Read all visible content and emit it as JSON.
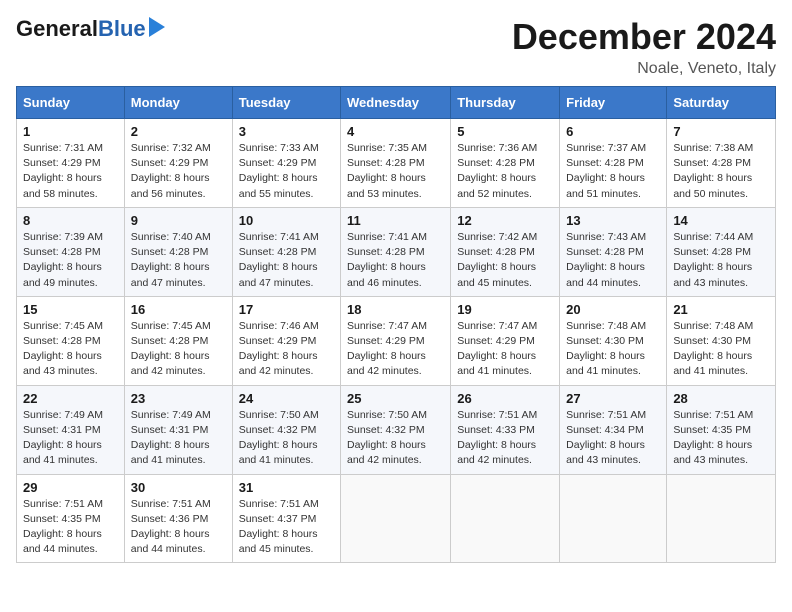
{
  "logo": {
    "general": "General",
    "blue": "Blue"
  },
  "title": "December 2024",
  "location": "Noale, Veneto, Italy",
  "days_of_week": [
    "Sunday",
    "Monday",
    "Tuesday",
    "Wednesday",
    "Thursday",
    "Friday",
    "Saturday"
  ],
  "weeks": [
    [
      {
        "day": 1,
        "sunrise": "7:31 AM",
        "sunset": "4:29 PM",
        "daylight": "8 hours and 58 minutes."
      },
      {
        "day": 2,
        "sunrise": "7:32 AM",
        "sunset": "4:29 PM",
        "daylight": "8 hours and 56 minutes."
      },
      {
        "day": 3,
        "sunrise": "7:33 AM",
        "sunset": "4:29 PM",
        "daylight": "8 hours and 55 minutes."
      },
      {
        "day": 4,
        "sunrise": "7:35 AM",
        "sunset": "4:28 PM",
        "daylight": "8 hours and 53 minutes."
      },
      {
        "day": 5,
        "sunrise": "7:36 AM",
        "sunset": "4:28 PM",
        "daylight": "8 hours and 52 minutes."
      },
      {
        "day": 6,
        "sunrise": "7:37 AM",
        "sunset": "4:28 PM",
        "daylight": "8 hours and 51 minutes."
      },
      {
        "day": 7,
        "sunrise": "7:38 AM",
        "sunset": "4:28 PM",
        "daylight": "8 hours and 50 minutes."
      }
    ],
    [
      {
        "day": 8,
        "sunrise": "7:39 AM",
        "sunset": "4:28 PM",
        "daylight": "8 hours and 49 minutes."
      },
      {
        "day": 9,
        "sunrise": "7:40 AM",
        "sunset": "4:28 PM",
        "daylight": "8 hours and 47 minutes."
      },
      {
        "day": 10,
        "sunrise": "7:41 AM",
        "sunset": "4:28 PM",
        "daylight": "8 hours and 47 minutes."
      },
      {
        "day": 11,
        "sunrise": "7:41 AM",
        "sunset": "4:28 PM",
        "daylight": "8 hours and 46 minutes."
      },
      {
        "day": 12,
        "sunrise": "7:42 AM",
        "sunset": "4:28 PM",
        "daylight": "8 hours and 45 minutes."
      },
      {
        "day": 13,
        "sunrise": "7:43 AM",
        "sunset": "4:28 PM",
        "daylight": "8 hours and 44 minutes."
      },
      {
        "day": 14,
        "sunrise": "7:44 AM",
        "sunset": "4:28 PM",
        "daylight": "8 hours and 43 minutes."
      }
    ],
    [
      {
        "day": 15,
        "sunrise": "7:45 AM",
        "sunset": "4:28 PM",
        "daylight": "8 hours and 43 minutes."
      },
      {
        "day": 16,
        "sunrise": "7:45 AM",
        "sunset": "4:28 PM",
        "daylight": "8 hours and 42 minutes."
      },
      {
        "day": 17,
        "sunrise": "7:46 AM",
        "sunset": "4:29 PM",
        "daylight": "8 hours and 42 minutes."
      },
      {
        "day": 18,
        "sunrise": "7:47 AM",
        "sunset": "4:29 PM",
        "daylight": "8 hours and 42 minutes."
      },
      {
        "day": 19,
        "sunrise": "7:47 AM",
        "sunset": "4:29 PM",
        "daylight": "8 hours and 41 minutes."
      },
      {
        "day": 20,
        "sunrise": "7:48 AM",
        "sunset": "4:30 PM",
        "daylight": "8 hours and 41 minutes."
      },
      {
        "day": 21,
        "sunrise": "7:48 AM",
        "sunset": "4:30 PM",
        "daylight": "8 hours and 41 minutes."
      }
    ],
    [
      {
        "day": 22,
        "sunrise": "7:49 AM",
        "sunset": "4:31 PM",
        "daylight": "8 hours and 41 minutes."
      },
      {
        "day": 23,
        "sunrise": "7:49 AM",
        "sunset": "4:31 PM",
        "daylight": "8 hours and 41 minutes."
      },
      {
        "day": 24,
        "sunrise": "7:50 AM",
        "sunset": "4:32 PM",
        "daylight": "8 hours and 41 minutes."
      },
      {
        "day": 25,
        "sunrise": "7:50 AM",
        "sunset": "4:32 PM",
        "daylight": "8 hours and 42 minutes."
      },
      {
        "day": 26,
        "sunrise": "7:51 AM",
        "sunset": "4:33 PM",
        "daylight": "8 hours and 42 minutes."
      },
      {
        "day": 27,
        "sunrise": "7:51 AM",
        "sunset": "4:34 PM",
        "daylight": "8 hours and 43 minutes."
      },
      {
        "day": 28,
        "sunrise": "7:51 AM",
        "sunset": "4:35 PM",
        "daylight": "8 hours and 43 minutes."
      }
    ],
    [
      {
        "day": 29,
        "sunrise": "7:51 AM",
        "sunset": "4:35 PM",
        "daylight": "8 hours and 44 minutes."
      },
      {
        "day": 30,
        "sunrise": "7:51 AM",
        "sunset": "4:36 PM",
        "daylight": "8 hours and 44 minutes."
      },
      {
        "day": 31,
        "sunrise": "7:51 AM",
        "sunset": "4:37 PM",
        "daylight": "8 hours and 45 minutes."
      },
      null,
      null,
      null,
      null
    ]
  ],
  "labels": {
    "sunrise": "Sunrise:",
    "sunset": "Sunset:",
    "daylight": "Daylight:"
  }
}
